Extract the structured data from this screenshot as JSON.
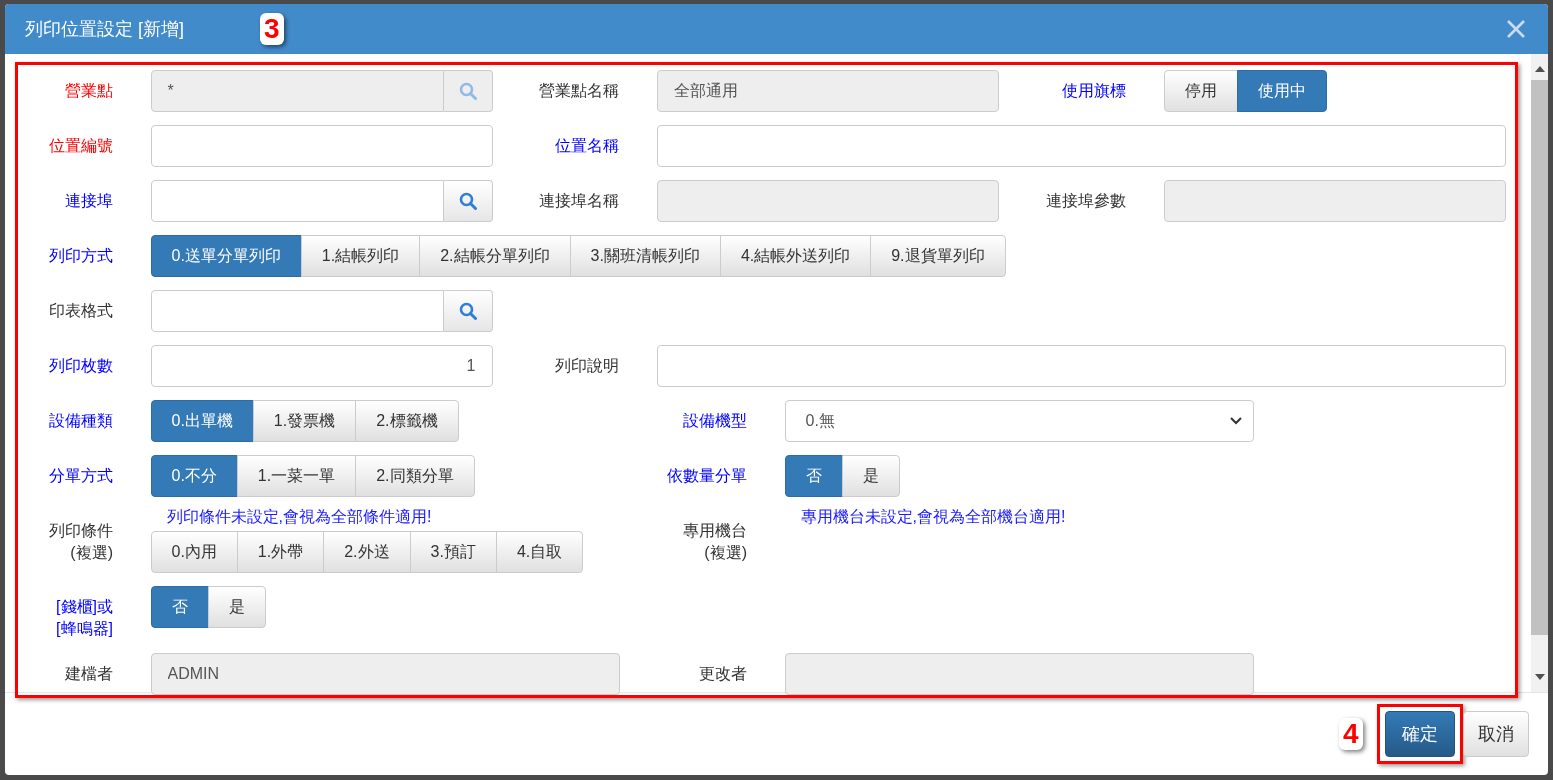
{
  "dialog": {
    "title": "列印位置設定 [新增]"
  },
  "rows": [
    {
      "kind": "thirds",
      "cells": [
        {
          "kind": "label",
          "text": "營業點",
          "color": "#ff0000"
        },
        {
          "kind": "input",
          "value": "*",
          "disabled": true,
          "search": {
            "disabled": true
          }
        },
        {
          "kind": "label",
          "text": "營業點名稱",
          "color": "#333333"
        },
        {
          "kind": "input",
          "value": "全部通用",
          "disabled": true
        },
        {
          "kind": "label",
          "text": "使用旗標",
          "color": "#0000ff"
        },
        {
          "kind": "segmented",
          "options": [
            {
              "label": "停用",
              "selected": false
            },
            {
              "label": "使用中",
              "selected": true
            }
          ]
        }
      ]
    },
    {
      "kind": "thirds_wide",
      "cells": [
        {
          "kind": "label",
          "text": "位置編號",
          "color": "#ff0000"
        },
        {
          "kind": "input",
          "disabled": false
        },
        {
          "kind": "label",
          "text": "位置名稱",
          "color": "#0000ff"
        },
        {
          "kind": "input",
          "disabled": false
        }
      ]
    },
    {
      "kind": "thirds",
      "cells": [
        {
          "kind": "label",
          "text": "連接埠",
          "color": "#0000ff"
        },
        {
          "kind": "input",
          "disabled": false,
          "search": {
            "disabled": false
          }
        },
        {
          "kind": "label",
          "text": "連接埠名稱",
          "color": "#333333"
        },
        {
          "kind": "input",
          "disabled": true
        },
        {
          "kind": "label",
          "text": "連接埠參數",
          "color": "#333333"
        },
        {
          "kind": "input",
          "disabled": true
        }
      ]
    },
    {
      "kind": "thirds",
      "cells": [
        {
          "kind": "label",
          "text": "列印方式",
          "color": "#0000ff"
        },
        {
          "kind": "segmented",
          "options": [
            {
              "label": "0.送單分單列印",
              "selected": true
            },
            {
              "label": "1.結帳列印",
              "selected": false
            },
            {
              "label": "2.結帳分單列印",
              "selected": false
            },
            {
              "label": "3.關班清帳列印",
              "selected": false
            },
            {
              "label": "4.結帳外送列印",
              "selected": false
            },
            {
              "label": "9.退貨單列印",
              "selected": false
            }
          ]
        }
      ]
    },
    {
      "kind": "thirds",
      "cells": [
        {
          "kind": "label",
          "text": "印表格式",
          "color": "#333333"
        },
        {
          "kind": "input",
          "disabled": false,
          "search": {
            "disabled": false
          }
        }
      ]
    },
    {
      "kind": "thirds_wide",
      "cells": [
        {
          "kind": "label",
          "text": "列印枚數",
          "color": "#0000ff"
        },
        {
          "kind": "input",
          "value": "1",
          "disabled": false,
          "numeric": true
        },
        {
          "kind": "label",
          "text": "列印說明",
          "color": "#333333"
        },
        {
          "kind": "input",
          "disabled": false
        }
      ]
    },
    {
      "kind": "halves",
      "cells": [
        {
          "kind": "label",
          "text": "設備種類",
          "color": "#0000ff"
        },
        {
          "kind": "segmented",
          "options": [
            {
              "label": "0.出單機",
              "selected": true
            },
            {
              "label": "1.發票機",
              "selected": false
            },
            {
              "label": "2.標籤機",
              "selected": false
            }
          ]
        },
        {
          "kind": "label",
          "text": "設備機型",
          "color": "#0000ff"
        },
        {
          "kind": "select",
          "value": "0.無"
        }
      ]
    },
    {
      "kind": "halves",
      "cells": [
        {
          "kind": "label",
          "text": "分單方式",
          "color": "#0000ff"
        },
        {
          "kind": "segmented",
          "options": [
            {
              "label": "0.不分",
              "selected": true
            },
            {
              "label": "1.一菜一單",
              "selected": false
            },
            {
              "label": "2.同類分單",
              "selected": false
            }
          ]
        },
        {
          "kind": "label",
          "text": "依數量分單",
          "color": "#0000ff"
        },
        {
          "kind": "segmented",
          "options": [
            {
              "label": "否",
              "selected": true
            },
            {
              "label": "是",
              "selected": false
            }
          ]
        }
      ]
    },
    {
      "kind": "halves",
      "cells": [
        {
          "kind": "label",
          "text": "列印條件 (複選)",
          "color": "#333333"
        },
        {
          "kind": "segmented",
          "hint": "列印條件未設定,會視為全部條件適用!",
          "options": [
            {
              "label": "0.內用",
              "selected": false
            },
            {
              "label": "1.外帶",
              "selected": false
            },
            {
              "label": "2.外送",
              "selected": false
            },
            {
              "label": "3.預訂",
              "selected": false
            },
            {
              "label": "4.自取",
              "selected": false
            }
          ]
        },
        {
          "kind": "label",
          "text": "專用機台 (複選)",
          "color": "#333333"
        },
        {
          "kind": "note",
          "text": "專用機台未設定,會視為全部機台適用!"
        }
      ]
    },
    {
      "kind": "halves",
      "cells": [
        {
          "kind": "label",
          "text": "[錢櫃]或[蜂鳴器]",
          "color": "#0000ff"
        },
        {
          "kind": "segmented",
          "options": [
            {
              "label": "否",
              "selected": true
            },
            {
              "label": "是",
              "selected": false
            }
          ]
        }
      ]
    },
    {
      "kind": "halves",
      "cells": [
        {
          "kind": "label",
          "text": "建檔者",
          "color": "#333333"
        },
        {
          "kind": "input",
          "value": "ADMIN",
          "disabled": true
        },
        {
          "kind": "label",
          "text": "更改者",
          "color": "#333333"
        },
        {
          "kind": "input",
          "disabled": true
        }
      ]
    }
  ],
  "footer_buttons": [
    {
      "label": "確定",
      "kind": "primary"
    },
    {
      "label": "取消",
      "kind": "default"
    }
  ],
  "annotations": [
    {
      "label": "3",
      "kind": "form"
    },
    {
      "label": "4",
      "kind": "primary_button"
    }
  ]
}
